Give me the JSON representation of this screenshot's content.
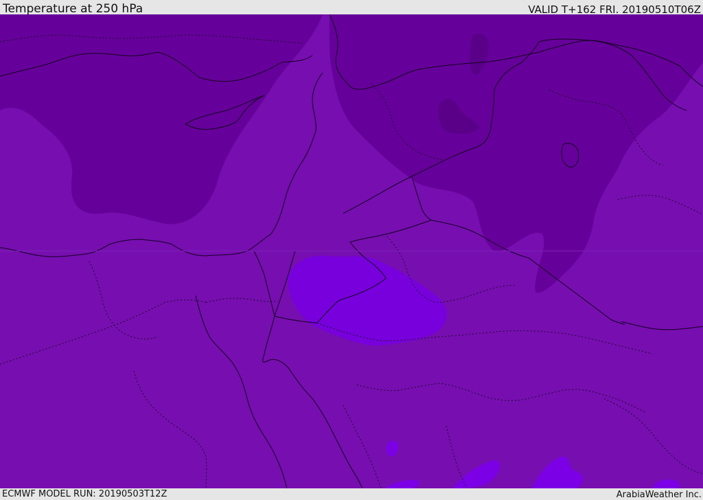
{
  "header": {
    "title": "Temperature at 250 hPa",
    "valid": "VALID T+162 FRI. 20190510T06Z"
  },
  "footer": {
    "run": "ECMWF MODEL RUN: 20190503T12Z",
    "credit": "ArabiaWeather Inc."
  },
  "legend_colors": {
    "cold": "#5f0094",
    "base": "#770eb0",
    "warm": "#7a00e0",
    "warmer": "#8a10ee",
    "coldest": "#520080"
  }
}
